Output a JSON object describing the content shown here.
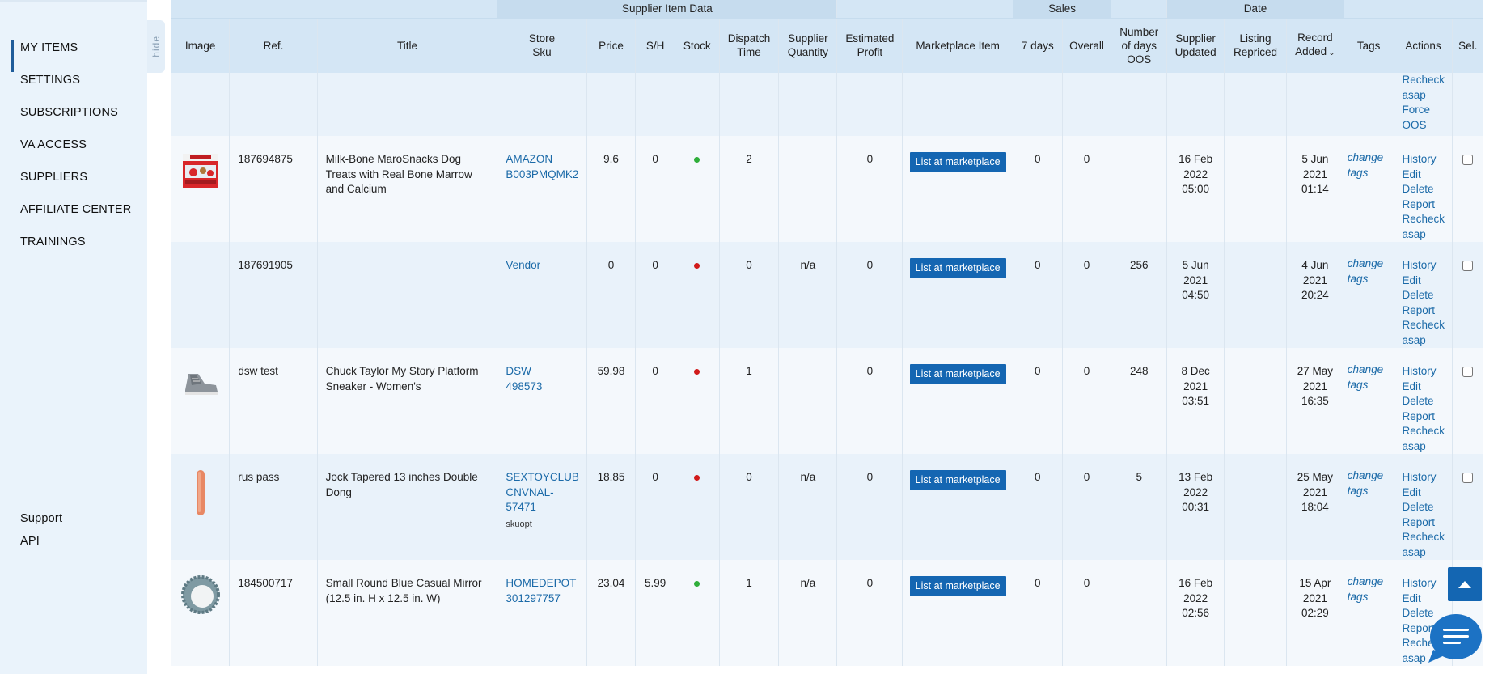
{
  "sidebar": {
    "hide_label": "hide",
    "items": [
      {
        "label": "MY ITEMS",
        "active": true
      },
      {
        "label": "SETTINGS"
      },
      {
        "label": "SUBSCRIPTIONS"
      },
      {
        "label": "VA ACCESS"
      },
      {
        "label": "SUPPLIERS"
      },
      {
        "label": "AFFILIATE CENTER"
      },
      {
        "label": "TRAININGS"
      }
    ],
    "bottom": [
      {
        "label": "Support"
      },
      {
        "label": "API"
      }
    ]
  },
  "table": {
    "groups": {
      "supplier": "Supplier Item Data",
      "sales": "Sales",
      "date": "Date"
    },
    "columns": {
      "image": "Image",
      "ref": "Ref.",
      "title": "Title",
      "store_sku_1": "Store",
      "store_sku_2": "Sku",
      "price": "Price",
      "sh": "S/H",
      "stock": "Stock",
      "dispatch_1": "Dispatch",
      "dispatch_2": "Time",
      "supqty_1": "Supplier",
      "supqty_2": "Quantity",
      "profit_1": "Estimated",
      "profit_2": "Profit",
      "marketplace": "Marketplace Item",
      "sales_7": "7 days",
      "sales_overall": "Overall",
      "oos_1": "Number",
      "oos_2": "of days",
      "oos_3": "OOS",
      "supupd_1": "Supplier",
      "supupd_2": "Updated",
      "repriced_1": "Listing",
      "repriced_2": "Repriced",
      "added_1": "Record",
      "added_2": "Added",
      "tags": "Tags",
      "actions": "Actions",
      "sel": "Sel."
    },
    "partial_actions": [
      "Recheck",
      "asap",
      "Force",
      "OOS"
    ],
    "list_button": "List at marketplace",
    "tags_link_1": "change",
    "tags_link_2": "tags",
    "action_labels": {
      "history": "History",
      "edit": "Edit",
      "delete": "Delete",
      "report": "Report",
      "recheck_1": "Recheck",
      "recheck_2": "asap"
    },
    "rows": [
      {
        "image": "dog-treats-box",
        "ref": "187694875",
        "title": "Milk-Bone MaroSnacks Dog Treats with Real Bone Marrow and Calcium",
        "store": "AMAZON",
        "sku": "B003PMQMK2",
        "sku_opt": "",
        "price": "9.6",
        "sh": "0",
        "stock": "green",
        "dispatch": "2",
        "supqty": "",
        "profit": "0",
        "sales_7": "0",
        "sales_overall": "0",
        "oos": "",
        "sup_updated_1": "16 Feb",
        "sup_updated_2": "2022",
        "sup_updated_3": "05:00",
        "repriced": "",
        "added_1": "5 Jun",
        "added_2": "2021",
        "added_3": "01:14"
      },
      {
        "image": "",
        "ref": "187691905",
        "title": "",
        "store": "Vendor",
        "sku": "",
        "sku_opt": "",
        "price": "0",
        "sh": "0",
        "stock": "red",
        "dispatch": "0",
        "supqty": "n/a",
        "profit": "0",
        "sales_7": "0",
        "sales_overall": "0",
        "oos": "256",
        "sup_updated_1": "5 Jun",
        "sup_updated_2": "2021",
        "sup_updated_3": "04:50",
        "repriced": "",
        "added_1": "4 Jun",
        "added_2": "2021",
        "added_3": "20:24"
      },
      {
        "image": "sneaker",
        "ref": "dsw test",
        "title": "Chuck Taylor My Story Platform Sneaker - Women's",
        "store": "DSW",
        "sku": "498573",
        "sku_opt": "",
        "price": "59.98",
        "sh": "0",
        "stock": "red",
        "dispatch": "1",
        "supqty": "",
        "profit": "0",
        "sales_7": "0",
        "sales_overall": "0",
        "oos": "248",
        "sup_updated_1": "8 Dec",
        "sup_updated_2": "2021",
        "sup_updated_3": "03:51",
        "repriced": "",
        "added_1": "27 May",
        "added_2": "2021",
        "added_3": "16:35"
      },
      {
        "image": "product-pink",
        "ref": "rus pass",
        "title": "Jock Tapered 13 inches Double Dong",
        "store": "SEXTOYCLUB",
        "sku": "CNVNAL-57471",
        "sku_a": "CNVNAL-",
        "sku_b": "57471",
        "sku_opt": "skuopt",
        "price": "18.85",
        "sh": "0",
        "stock": "red",
        "dispatch": "0",
        "supqty": "n/a",
        "profit": "0",
        "sales_7": "0",
        "sales_overall": "0",
        "oos": "5",
        "sup_updated_1": "13 Feb",
        "sup_updated_2": "2022",
        "sup_updated_3": "00:31",
        "repriced": "",
        "added_1": "25 May",
        "added_2": "2021",
        "added_3": "18:04"
      },
      {
        "image": "round-mirror",
        "ref": "184500717",
        "title": "Small Round Blue Casual Mirror (12.5 in. H x 12.5 in. W)",
        "store": "HOMEDEPOT",
        "sku": "301297757",
        "sku_opt": "",
        "price": "23.04",
        "sh": "5.99",
        "stock": "green",
        "dispatch": "1",
        "supqty": "n/a",
        "profit": "0",
        "sales_7": "0",
        "sales_overall": "0",
        "oos": "",
        "sup_updated_1": "16 Feb",
        "sup_updated_2": "2022",
        "sup_updated_3": "02:56",
        "repriced": "",
        "added_1": "15 Apr",
        "added_2": "2021",
        "added_3": "02:29"
      }
    ]
  },
  "colors": {
    "accent": "#1466b2",
    "link": "#1b6aa8",
    "stock_green": "#2fae3a",
    "stock_red": "#d11b1b",
    "sidebar_bg": "#eaf3fb",
    "header_bg": "#d4e6f5"
  },
  "icons": {
    "scroll_top": "arrow-up-icon",
    "chat": "chat-bubble-icon",
    "sort": "chevron-down-icon"
  }
}
